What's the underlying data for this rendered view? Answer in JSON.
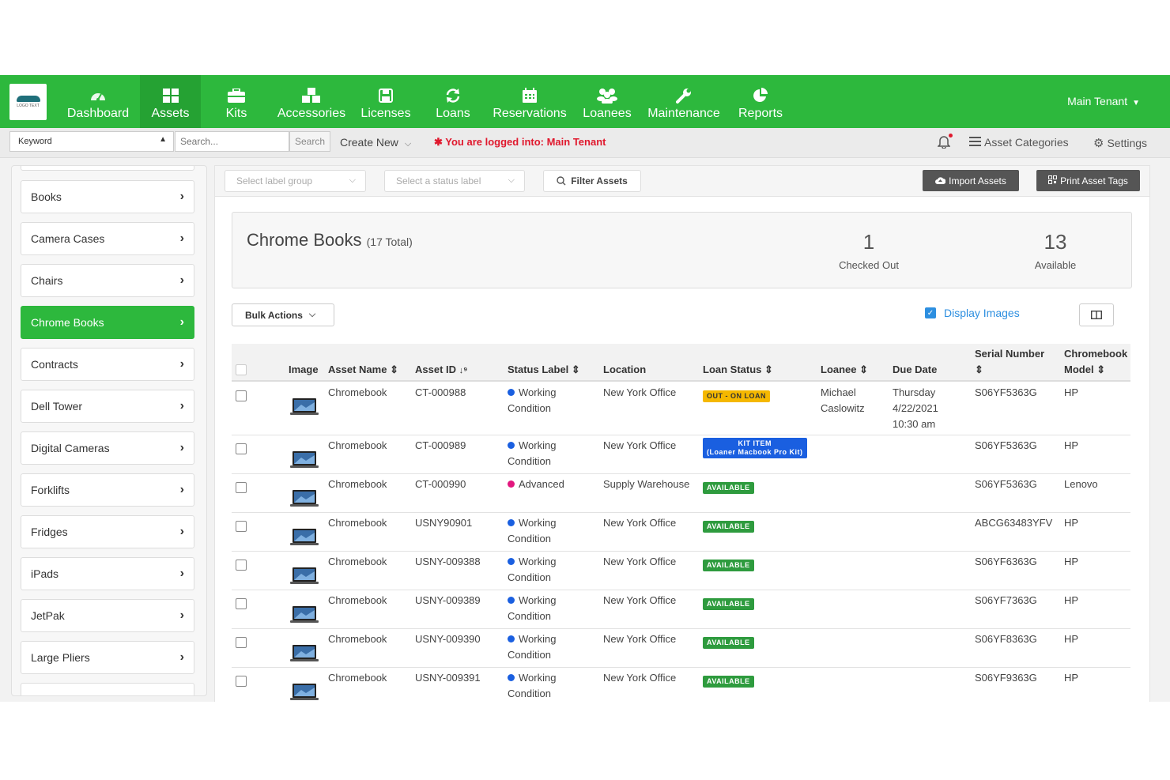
{
  "nav": {
    "logo_text": "LOGO TEXT",
    "items": [
      {
        "label": "Dashboard",
        "icon": "dashboard-icon"
      },
      {
        "label": "Assets",
        "icon": "grid-icon"
      },
      {
        "label": "Kits",
        "icon": "briefcase-icon"
      },
      {
        "label": "Accessories",
        "icon": "cubes-icon"
      },
      {
        "label": "Licenses",
        "icon": "floppy-icon"
      },
      {
        "label": "Loans",
        "icon": "refresh-icon"
      },
      {
        "label": "Reservations",
        "icon": "calendar-icon"
      },
      {
        "label": "Loanees",
        "icon": "users-icon"
      },
      {
        "label": "Maintenance",
        "icon": "wrench-icon"
      },
      {
        "label": "Reports",
        "icon": "pie-chart-icon"
      }
    ],
    "active": "Assets",
    "tenant": "Main Tenant"
  },
  "toolbar": {
    "keyword_select": "Keyword",
    "search_placeholder": "Search...",
    "search_button": "Search",
    "create_new": "Create New",
    "logged_in_msg": "You are logged into: Main Tenant",
    "asset_categories": "Asset Categories",
    "settings": "Settings"
  },
  "sidebar": {
    "items": [
      {
        "label": "Books"
      },
      {
        "label": "Camera Cases"
      },
      {
        "label": "Chairs"
      },
      {
        "label": "Chrome Books"
      },
      {
        "label": "Contracts"
      },
      {
        "label": "Dell Tower"
      },
      {
        "label": "Digital Cameras"
      },
      {
        "label": "Forklifts"
      },
      {
        "label": "Fridges"
      },
      {
        "label": "iPads"
      },
      {
        "label": "JetPak"
      },
      {
        "label": "Large Pliers"
      }
    ],
    "active": "Chrome Books"
  },
  "filters": {
    "label_group_placeholder": "Select label group",
    "status_label_placeholder": "Select a status label",
    "filter_button": "Filter Assets",
    "import_button": "Import Assets",
    "print_button": "Print Asset Tags"
  },
  "summary": {
    "title": "Chrome Books",
    "total": "(17 Total)",
    "checked_out_count": "1",
    "checked_out_label": "Checked Out",
    "available_count": "13",
    "available_label": "Available"
  },
  "actions": {
    "bulk_actions": "Bulk Actions",
    "display_images": "Display Images",
    "display_images_checked": true
  },
  "table": {
    "headers": {
      "image": "Image",
      "asset_name": "Asset Name",
      "asset_id": "Asset ID",
      "status_label": "Status Label",
      "location": "Location",
      "loan_status": "Loan Status",
      "loanee": "Loanee",
      "due_date": "Due Date",
      "serial_number": "Serial Number",
      "chromebook_model": "Chromebook Model"
    },
    "rows": [
      {
        "name": "Chromebook",
        "id": "CT-000988",
        "status1": "Working",
        "status2": "Condition",
        "status_color": "#1a5fe0",
        "location": "New York Office",
        "loan_status": "OUT - ON LOAN",
        "loan_color": "#f5b800",
        "loan_text_color": "#333333",
        "loanee1": "Michael",
        "loanee2": "Caslowitz",
        "due1": "Thursday",
        "due2": "4/22/2021",
        "due3": "10:30 am",
        "serial": "S06YF5363G",
        "model": "HP"
      },
      {
        "name": "Chromebook",
        "id": "CT-000989",
        "status1": "Working",
        "status2": "Condition",
        "status_color": "#1a5fe0",
        "location": "New York Office",
        "loan_status": "KIT ITEM",
        "loan_status_sub": "(Loaner Macbook Pro Kit)",
        "loan_color": "#1a5fe0",
        "loan_text_color": "#ffffff",
        "serial": "S06YF5363G",
        "model": "HP"
      },
      {
        "name": "Chromebook",
        "id": "CT-000990",
        "status1": "Advanced",
        "status2": "",
        "status_color": "#e2177e",
        "location": "Supply Warehouse",
        "loan_status": "AVAILABLE",
        "loan_color": "#2e9b3e",
        "loan_text_color": "#ffffff",
        "serial": "S06YF5363G",
        "model": "Lenovo"
      },
      {
        "name": "Chromebook",
        "id": "USNY90901",
        "status1": "Working",
        "status2": "Condition",
        "status_color": "#1a5fe0",
        "location": "New York Office",
        "loan_status": "AVAILABLE",
        "loan_color": "#2e9b3e",
        "loan_text_color": "#ffffff",
        "serial": "ABCG63483YFV",
        "model": "HP"
      },
      {
        "name": "Chromebook",
        "id": "USNY-009388",
        "status1": "Working",
        "status2": "Condition",
        "status_color": "#1a5fe0",
        "location": "New York Office",
        "loan_status": "AVAILABLE",
        "loan_color": "#2e9b3e",
        "loan_text_color": "#ffffff",
        "serial": "S06YF6363G",
        "model": "HP"
      },
      {
        "name": "Chromebook",
        "id": "USNY-009389",
        "status1": "Working",
        "status2": "Condition",
        "status_color": "#1a5fe0",
        "location": "New York Office",
        "loan_status": "AVAILABLE",
        "loan_color": "#2e9b3e",
        "loan_text_color": "#ffffff",
        "serial": "S06YF7363G",
        "model": "HP"
      },
      {
        "name": "Chromebook",
        "id": "USNY-009390",
        "status1": "Working",
        "status2": "Condition",
        "status_color": "#1a5fe0",
        "location": "New York Office",
        "loan_status": "AVAILABLE",
        "loan_color": "#2e9b3e",
        "loan_text_color": "#ffffff",
        "serial": "S06YF8363G",
        "model": "HP"
      },
      {
        "name": "Chromebook",
        "id": "USNY-009391",
        "status1": "Working",
        "status2": "Condition",
        "status_color": "#1a5fe0",
        "location": "New York Office",
        "loan_status": "AVAILABLE",
        "loan_color": "#2e9b3e",
        "loan_text_color": "#ffffff",
        "serial": "S06YF9363G",
        "model": "HP"
      }
    ]
  },
  "colors": {
    "brand_green": "#2db83d",
    "active_green": "#25a233",
    "alert_red": "#e0182d",
    "link_blue": "#2d8fe0"
  }
}
